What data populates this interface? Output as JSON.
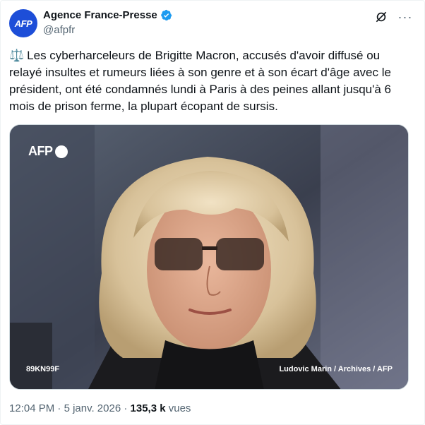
{
  "author": {
    "avatar_text": "AFP",
    "display_name": "Agence France-Presse",
    "handle": "@afpfr",
    "verified": true,
    "verified_color": "#1d9bf0"
  },
  "tweet": {
    "emoji_icon": "scales-icon",
    "text": "Les cyberharceleurs de Brigitte Macron, accusés d'avoir diffusé ou relayé insultes et rumeurs liées à son genre et à son écart d'âge avec le président, ont été condamnés lundi à Paris à des peines allant jusqu'à 6 mois de prison ferme, la plupart écopant de sursis."
  },
  "media": {
    "watermark": "AFP",
    "photo_id": "89KN99F",
    "credit": "Ludovic Marin / Archives / AFP"
  },
  "footer": {
    "time": "12:04 PM",
    "separator": "·",
    "date": "5 janv. 2026",
    "views_count": "135,3 k",
    "views_label": "vues"
  },
  "colors": {
    "text_primary": "#0f1419",
    "text_secondary": "#536471",
    "avatar_bg": "#1d4ed8"
  }
}
